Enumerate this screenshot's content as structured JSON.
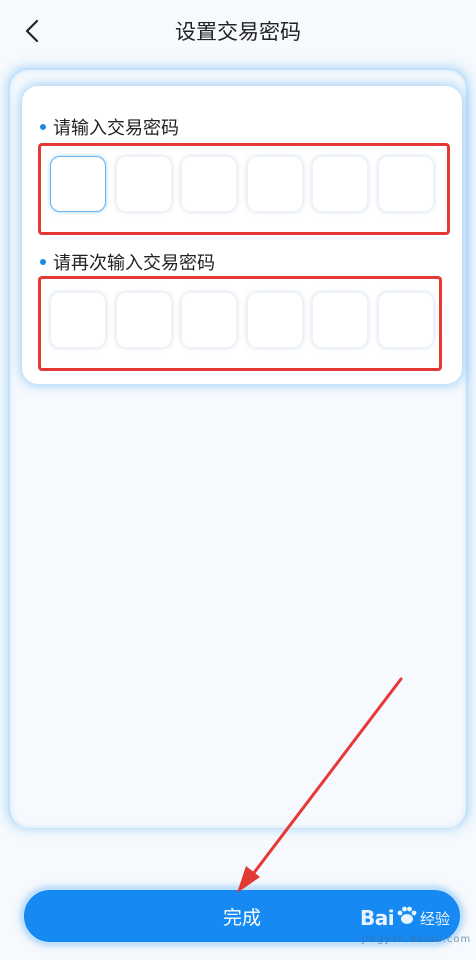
{
  "header": {
    "title": "设置交易密码",
    "back_icon": "chevron-left-icon"
  },
  "form": {
    "password_label": "请输入交易密码",
    "confirm_label": "请再次输入交易密码",
    "pin_length": 6,
    "active_box_index": 0,
    "password_value": [
      "",
      "",
      "",
      "",
      "",
      ""
    ],
    "confirm_value": [
      "",
      "",
      "",
      "",
      "",
      ""
    ]
  },
  "footer": {
    "submit_label": "完成"
  },
  "watermark": {
    "brand": "Bai",
    "brand_suffix": "经验",
    "url": "jingyan.baidu.com"
  },
  "colors": {
    "accent": "#1689f3",
    "annotation": "#e53935",
    "background": "#f6f9fd",
    "dot": "#1e88e5"
  }
}
